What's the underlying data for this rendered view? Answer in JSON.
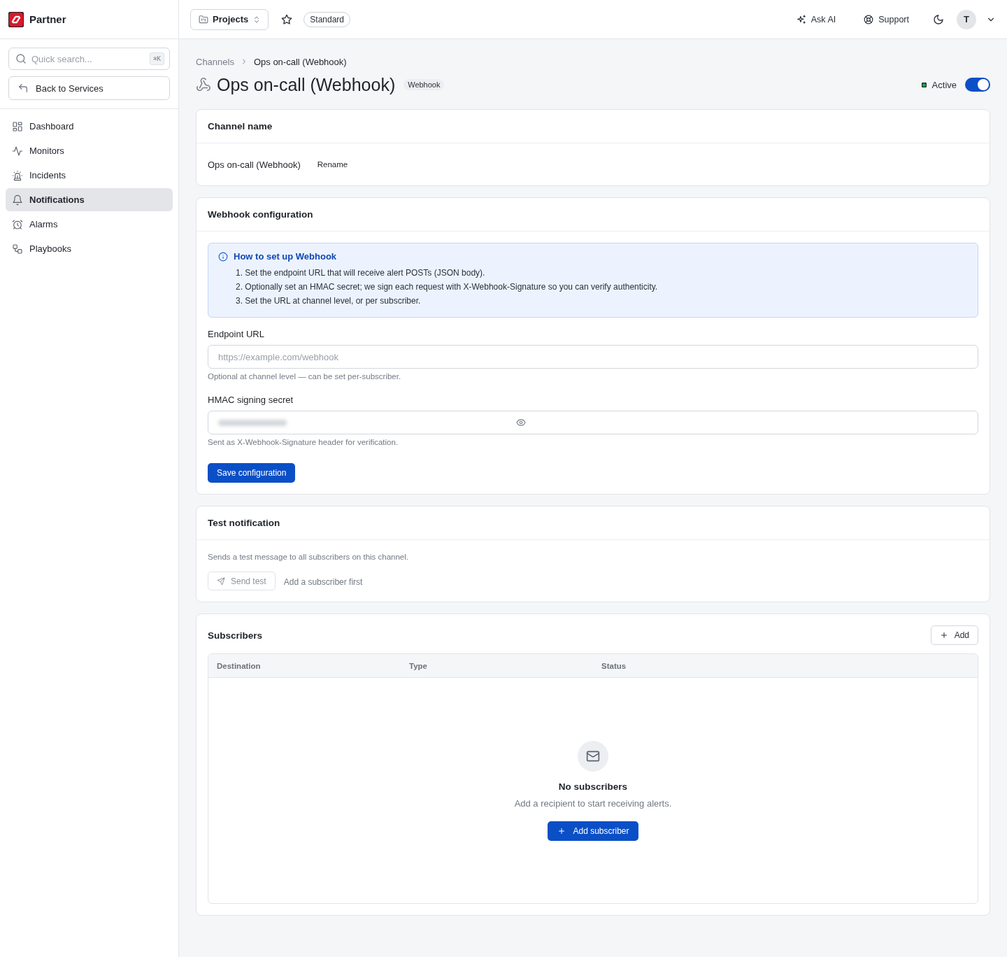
{
  "sidebar": {
    "brand": "Partner",
    "search": {
      "placeholder": "Quick search...",
      "shortcut": "⌘K"
    },
    "back_button": "Back to Services",
    "items": [
      {
        "label": "Dashboard",
        "selected": false
      },
      {
        "label": "Monitors",
        "selected": false
      },
      {
        "label": "Incidents",
        "selected": false
      },
      {
        "label": "Notifications",
        "selected": true
      },
      {
        "label": "Alarms",
        "selected": false
      },
      {
        "label": "Playbooks",
        "selected": false
      }
    ]
  },
  "top_bar": {
    "projects_button": "Projects",
    "plan_badge": "Standard",
    "ask_ai_button": "Ask AI",
    "support_button": "Support",
    "avatar_initial": "T"
  },
  "breadcrumb": {
    "parent": "Channels",
    "current": "Ops on-call (Webhook)"
  },
  "page_header": {
    "title": "Ops on-call (Webhook)",
    "type_badge": "Webhook",
    "status": "Active",
    "active": true
  },
  "channel_name": {
    "title": "Channel name",
    "value": "Ops on-call (Webhook)",
    "rename_button": "Rename"
  },
  "webhook_configuration": {
    "title": "Webhook configuration",
    "info": {
      "title": "How to set up Webhook",
      "steps": [
        "1. Set the endpoint URL that will receive alert POSTs (JSON body).",
        "2. Optionally set an HMAC secret; we sign each request with X-Webhook-Signature so you can verify authenticity.",
        "3. Set the URL at channel level, or per subscriber."
      ]
    },
    "fields": [
      {
        "kind": "url",
        "label": "Endpoint URL",
        "placeholder": "https://example.com/webhook",
        "hint": "Optional at channel level — can be set per-subscriber."
      },
      {
        "kind": "secret",
        "label": "HMAC signing secret",
        "masked": true,
        "hint": "Sent as X-Webhook-Signature header for verification."
      }
    ],
    "save_button": "Save configuration"
  },
  "test_notification": {
    "title": "Test notification",
    "description": "Sends a test message to all subscribers on this channel.",
    "send_button": {
      "label": "Send test",
      "disabled": true
    },
    "note": "Add a subscriber first"
  },
  "subscribers": {
    "title": "Subscribers",
    "add_button": "Add",
    "table": {
      "columns": [
        "Destination",
        "Type",
        "Status"
      ]
    },
    "empty_state": {
      "title": "No subscribers",
      "description": "Add a recipient to start receiving alerts.",
      "button": "Add subscriber"
    }
  }
}
